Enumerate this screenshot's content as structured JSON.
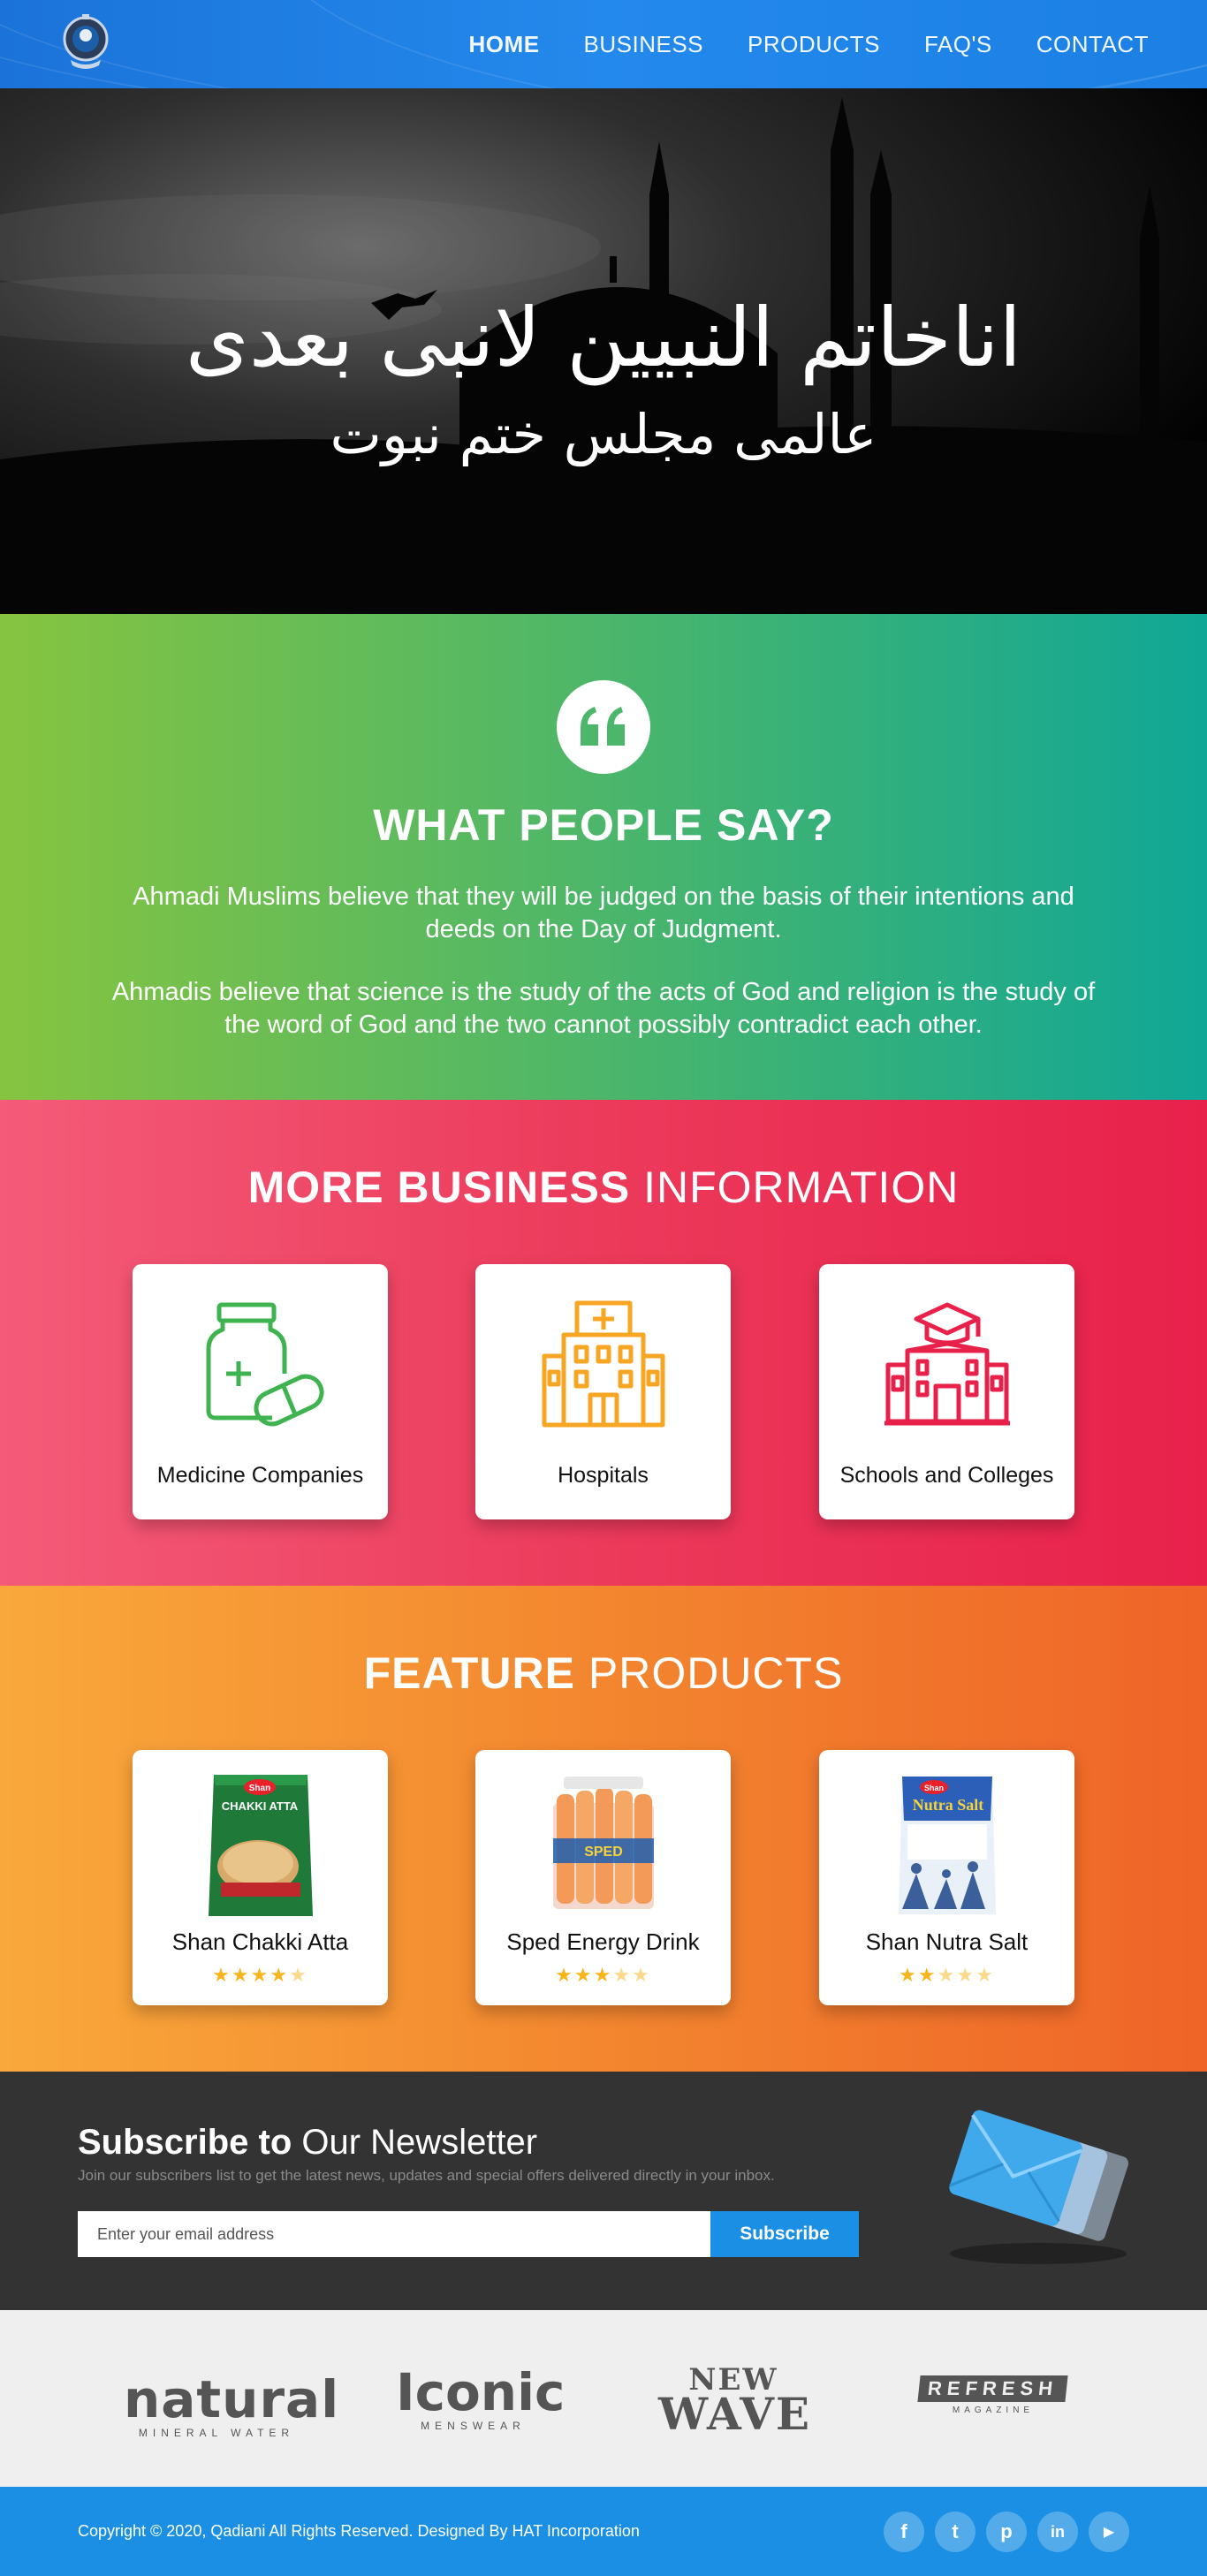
{
  "nav": {
    "links": [
      {
        "label": "HOME",
        "active": true
      },
      {
        "label": "BUSINESS",
        "active": false
      },
      {
        "label": "PRODUCTS",
        "active": false
      },
      {
        "label": "FAQ'S",
        "active": false
      },
      {
        "label": "CONTACT",
        "active": false
      }
    ],
    "logo_icon": "emblem-logo-icon"
  },
  "hero": {
    "line1": "اناخاتم النبیین لانبی بعدی",
    "line2": "عالمی مجلس ختم نبوت"
  },
  "testimonial": {
    "icon": "quote-icon",
    "title": "WHAT PEOPLE SAY?",
    "paragraphs": [
      "Ahmadi Muslims believe that they will be judged on the basis of their intentions and deeds on the Day of Judgment.",
      "Ahmadis believe that science is the study of the acts of God and religion is the study of the word of God and the two cannot possibly contradict each other."
    ]
  },
  "business": {
    "title_bold": "MORE BUSINESS",
    "title_light": " INFORMATION",
    "cards": [
      {
        "label": "Medicine Companies",
        "icon": "medicine-bottle-icon",
        "color": "#3fb34f"
      },
      {
        "label": "Hospitals",
        "icon": "hospital-icon",
        "color": "#f6a623"
      },
      {
        "label": "Schools and Colleges",
        "icon": "school-icon",
        "color": "#e8214b"
      }
    ]
  },
  "products": {
    "title_bold": "FEATURE",
    "title_light": " PRODUCTS",
    "items": [
      {
        "label": "Shan Chakki Atta",
        "rating": 4
      },
      {
        "label": "Sped Energy Drink",
        "rating": 3
      },
      {
        "label": "Shan Nutra Salt",
        "rating": 2
      }
    ]
  },
  "newsletter": {
    "title_bold": "Subscribe to",
    "title_light": " Our Newsletter",
    "subtitle": "Join our subscribers list to get the latest news, updates and special offers delivered directly in your inbox.",
    "placeholder": "Enter your email address",
    "button": "Subscribe",
    "icon": "envelope-icon"
  },
  "brands": {
    "b1_big": "natural",
    "b1_small": "MINERAL WATER",
    "b2_big": "Iconic",
    "b2_small": "MENSWEAR",
    "b3_top": "NEW",
    "b3_bottom": "WAVE",
    "b4_big": "REFRESH",
    "b4_small": "MAGAZINE"
  },
  "footer": {
    "copyright": "Copyright © 2020, Qadiani All Rights Reserved. Designed By HAT Incorporation",
    "socials": [
      {
        "icon": "facebook-icon",
        "glyph": "f"
      },
      {
        "icon": "twitter-icon",
        "glyph": "t"
      },
      {
        "icon": "pinterest-icon",
        "glyph": "p"
      },
      {
        "icon": "linkedin-icon",
        "glyph": "in"
      },
      {
        "icon": "youtube-icon",
        "glyph": "▶"
      }
    ]
  },
  "colors": {
    "nav": "#1b7fe4",
    "green": "#86c440",
    "teal": "#10a796",
    "pink": "#ec3a5b",
    "orange": "#f3862f",
    "dark": "#333333",
    "footer": "#1a8fe3",
    "star": "#f7b41b"
  }
}
